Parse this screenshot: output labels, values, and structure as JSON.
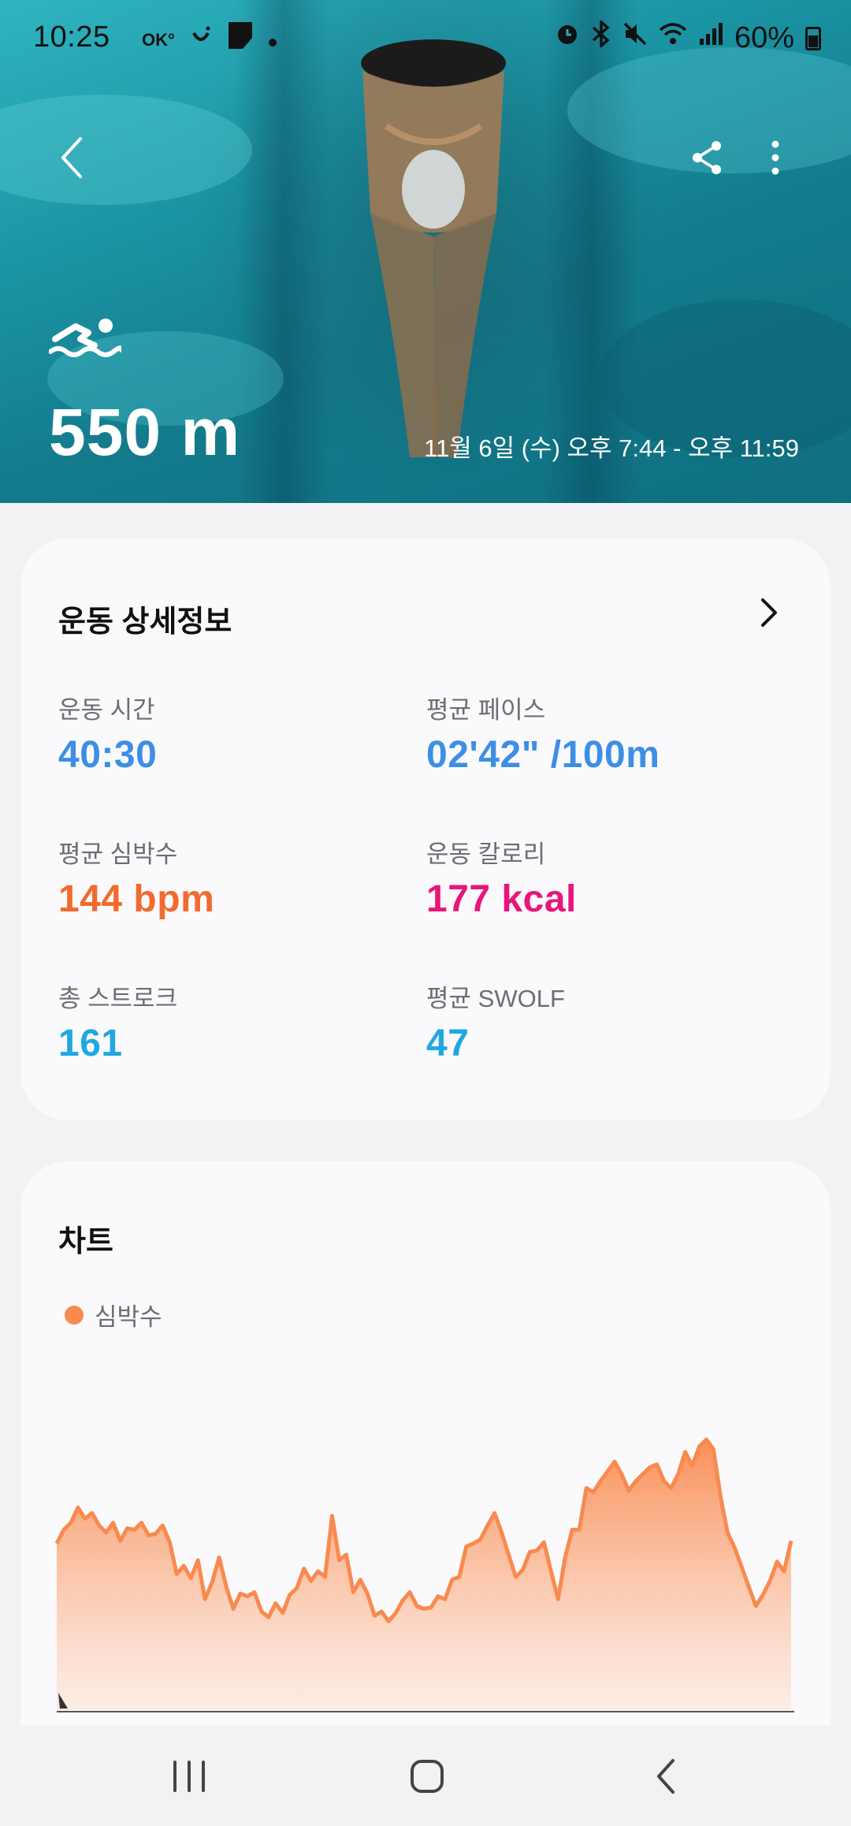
{
  "status_bar": {
    "time": "10:25",
    "battery": "60%",
    "battery_level": 0.6,
    "left_icons": [
      "ok-icon",
      "smile-icon",
      "notification-square-icon",
      "dot-icon"
    ],
    "right_icons": [
      "alarm-icon",
      "bluetooth-icon",
      "mute-icon",
      "wifi-icon",
      "signal-icon",
      "battery-icon"
    ]
  },
  "header": {
    "activity_icon": "swimming-icon",
    "distance": "550 m",
    "session_time": "11월 6일 (수) 오후 7:44 - 오후 11:59"
  },
  "details": {
    "title": "운동 상세정보",
    "metrics": [
      {
        "label": "운동 시간",
        "value": "40:30",
        "color": "#3d8ee6"
      },
      {
        "label": "평균 페이스",
        "value": "02'42\" /100m",
        "color": "#3d8ee6"
      },
      {
        "label": "평균 심박수",
        "value": "144 bpm",
        "color": "#f26a2e"
      },
      {
        "label": "운동 칼로리",
        "value": "177 kcal",
        "color": "#e8167a"
      },
      {
        "label": "총 스트로크",
        "value": "161",
        "color": "#20a8e0"
      },
      {
        "label": "평균 SWOLF",
        "value": "47",
        "color": "#20a8e0"
      }
    ]
  },
  "chart_section": {
    "title": "차트",
    "legend": [
      {
        "label": "심박수",
        "color": "#f98a4f"
      }
    ]
  },
  "chart_data": {
    "type": "area",
    "series": [
      {
        "name": "심박수",
        "color": "#f98a4f",
        "values": [
          120,
          130,
          135,
          146,
          138,
          142,
          133,
          128,
          135,
          122,
          131,
          130,
          135,
          126,
          127,
          133,
          121,
          98,
          104,
          95,
          108,
          80,
          92,
          110,
          89,
          73,
          84,
          82,
          85,
          71,
          67,
          77,
          70,
          83,
          88,
          102,
          93,
          100,
          96,
          140,
          108,
          112,
          85,
          94,
          84,
          68,
          71,
          64,
          70,
          79,
          85,
          75,
          73,
          74,
          82,
          80,
          94,
          96,
          118,
          120,
          123,
          133,
          142,
          128,
          112,
          96,
          101,
          114,
          115,
          121,
          100,
          80,
          110,
          130,
          130,
          160,
          157,
          165,
          172,
          179,
          170,
          158,
          165,
          170,
          175,
          177,
          165,
          160,
          170,
          186,
          176,
          190,
          195,
          188,
          154,
          128,
          117,
          103,
          89,
          75,
          83,
          93,
          107,
          100,
          122
        ]
      }
    ],
    "ylim": [
      0,
      250
    ],
    "grid": false,
    "legend_position": "top-left"
  },
  "nav": {
    "recents": "recents-icon",
    "home": "home-icon",
    "back": "back-icon"
  }
}
